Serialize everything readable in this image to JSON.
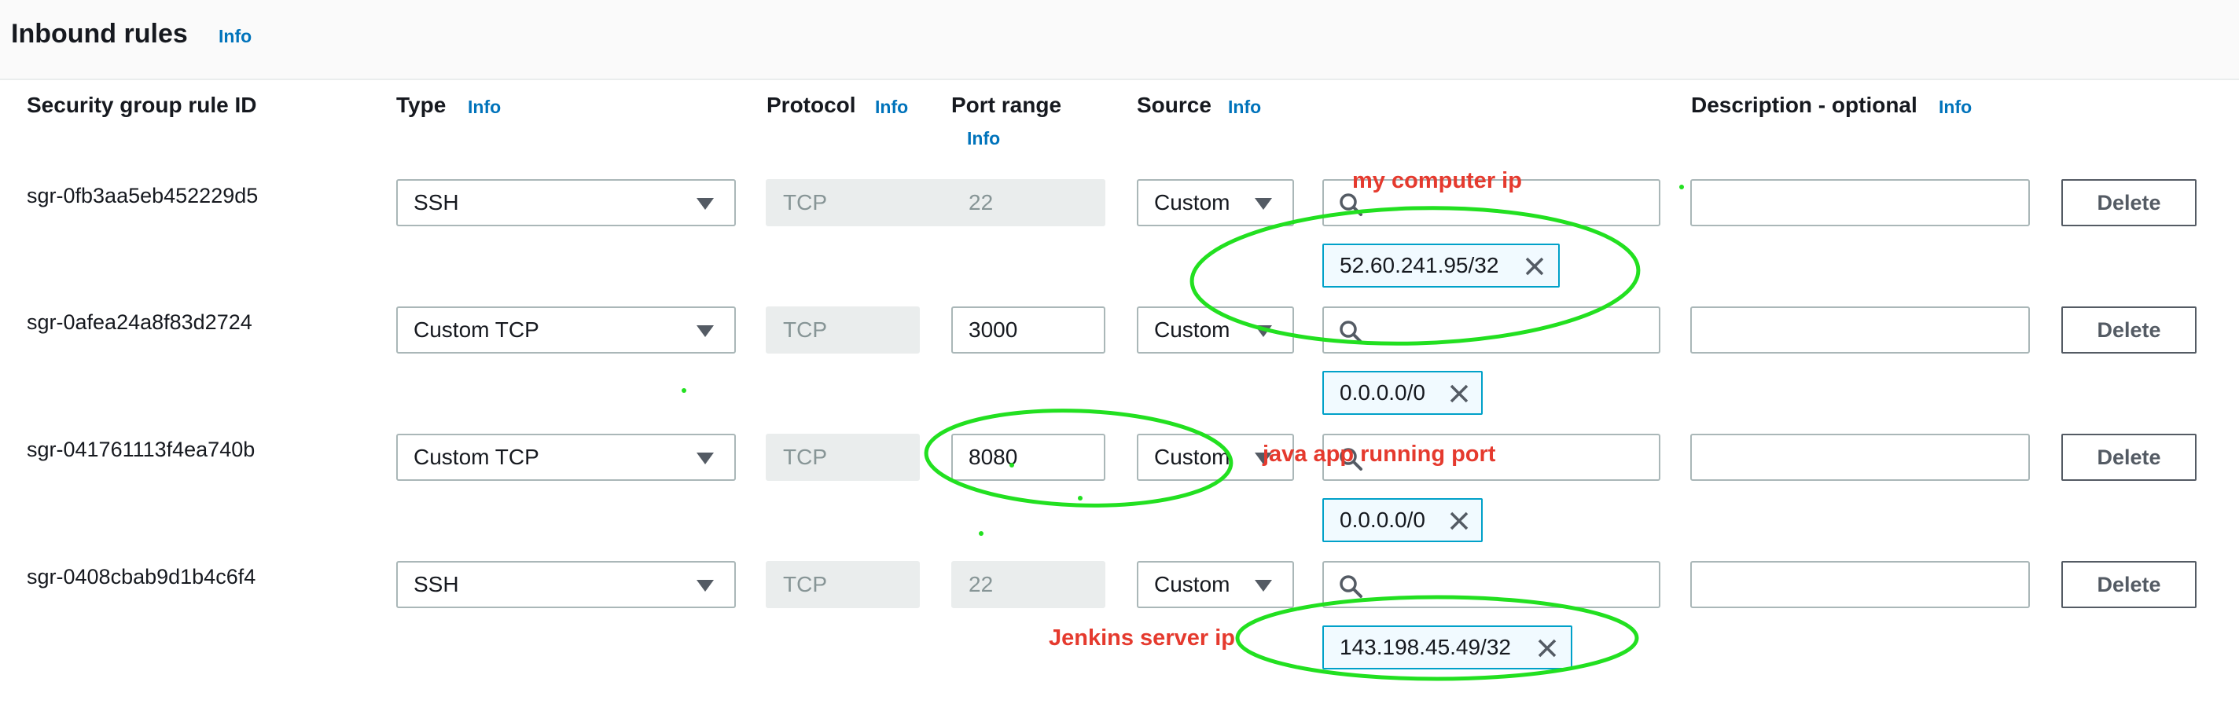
{
  "header": {
    "title": "Inbound rules",
    "info": "Info"
  },
  "columns": {
    "rule_id": "Security group rule ID",
    "type": "Type",
    "protocol": "Protocol",
    "port_range": "Port range",
    "source": "Source",
    "description": "Description - optional",
    "info": "Info"
  },
  "rows": [
    {
      "id": "sgr-0fb3aa5eb452229d5",
      "type": "SSH",
      "protocol": "TCP",
      "port": "22",
      "port_editable": false,
      "source": "Custom",
      "search_value": "",
      "cidr": "52.60.241.95/32",
      "description": "",
      "delete": "Delete"
    },
    {
      "id": "sgr-0afea24a8f83d2724",
      "type": "Custom TCP",
      "protocol": "TCP",
      "port": "3000",
      "port_editable": true,
      "source": "Custom",
      "search_value": "",
      "cidr": "0.0.0.0/0",
      "description": "",
      "delete": "Delete"
    },
    {
      "id": "sgr-041761113f4ea740b",
      "type": "Custom TCP",
      "protocol": "TCP",
      "port": "8080",
      "port_editable": true,
      "source": "Custom",
      "search_value": "",
      "cidr": "0.0.0.0/0",
      "description": "",
      "delete": "Delete"
    },
    {
      "id": "sgr-0408cbab9d1b4c6f4",
      "type": "SSH",
      "protocol": "TCP",
      "port": "22",
      "port_editable": false,
      "source": "Custom",
      "search_value": "",
      "cidr": "143.198.45.49/32",
      "description": "",
      "delete": "Delete"
    }
  ],
  "annotations": {
    "my_computer_ip": "my computer ip",
    "java_app_port": "java app running port",
    "jenkins_server_ip": "Jenkins server ip",
    "color_text": "#e53a2e",
    "color_ellipse": "#22e020"
  },
  "icons": {
    "dropdown": "caret-down-icon",
    "search": "search-icon",
    "remove_chip": "close-icon"
  },
  "colors": {
    "link": "#0073bb",
    "chip_border": "#00a1c9",
    "chip_bg": "#f1faff",
    "disabled_bg": "#eaeded"
  }
}
